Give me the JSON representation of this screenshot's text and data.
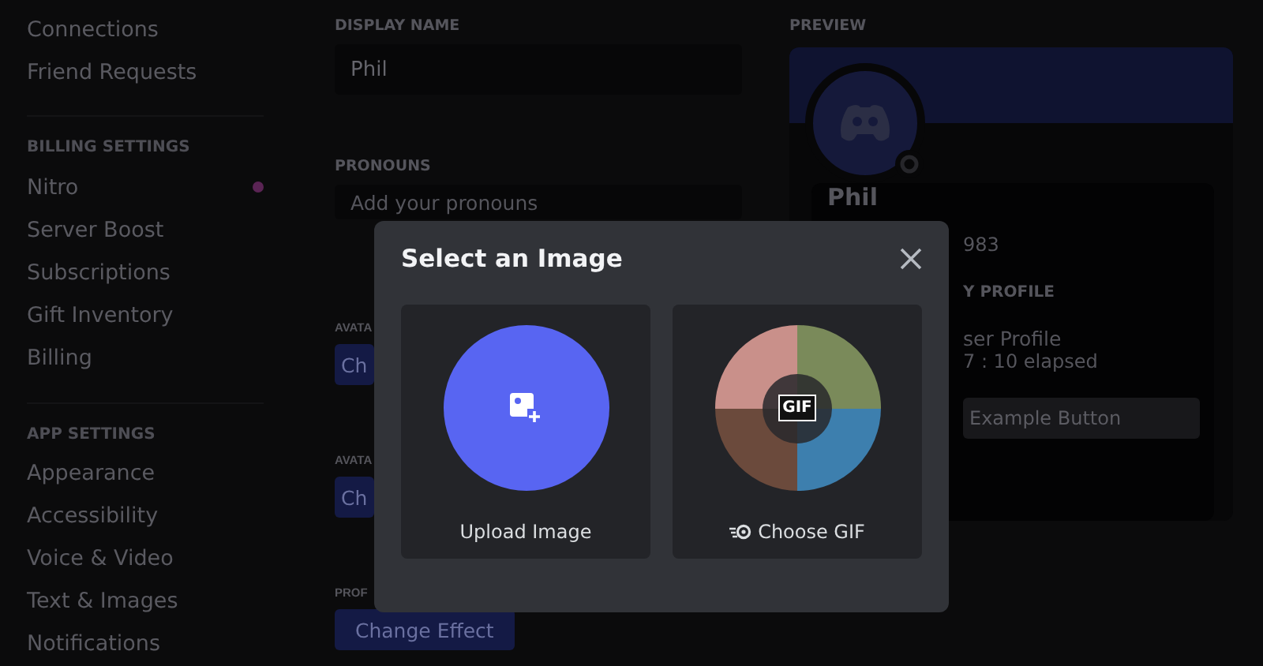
{
  "sidebar": {
    "sections": [
      {
        "items": [
          {
            "label": "Connections",
            "badge": false
          },
          {
            "label": "Friend Requests",
            "badge": false
          }
        ]
      },
      {
        "header": "BILLING SETTINGS",
        "items": [
          {
            "label": "Nitro",
            "badge": true
          },
          {
            "label": "Server Boost",
            "badge": false
          },
          {
            "label": "Subscriptions",
            "badge": false
          },
          {
            "label": "Gift Inventory",
            "badge": false
          },
          {
            "label": "Billing",
            "badge": false
          }
        ]
      },
      {
        "header": "APP SETTINGS",
        "items": [
          {
            "label": "Appearance",
            "badge": false
          },
          {
            "label": "Accessibility",
            "badge": false
          },
          {
            "label": "Voice & Video",
            "badge": false
          },
          {
            "label": "Text & Images",
            "badge": false
          },
          {
            "label": "Notifications",
            "badge": false
          }
        ]
      }
    ]
  },
  "editor": {
    "display_name": {
      "label": "DISPLAY NAME",
      "value": "Phil"
    },
    "pronouns": {
      "label": "PRONOUNS",
      "placeholder": "Add your pronouns"
    },
    "sections": [
      {
        "label": "AVATA",
        "button": "Ch"
      },
      {
        "label": "AVATA",
        "button": "Ch"
      },
      {
        "label": "PROF",
        "button": "Change Effect"
      }
    ]
  },
  "preview": {
    "label": "PREVIEW",
    "name": "Phil",
    "tag": "983",
    "section": "Y PROFILE",
    "activity": [
      "ser Profile",
      "7 : 10 elapsed"
    ],
    "button": "Example Button"
  },
  "modal": {
    "title": "Select an Image",
    "options": [
      {
        "kind": "upload",
        "label": "Upload Image"
      },
      {
        "kind": "gif",
        "label": "Choose GIF",
        "badge": "GIF"
      }
    ]
  }
}
